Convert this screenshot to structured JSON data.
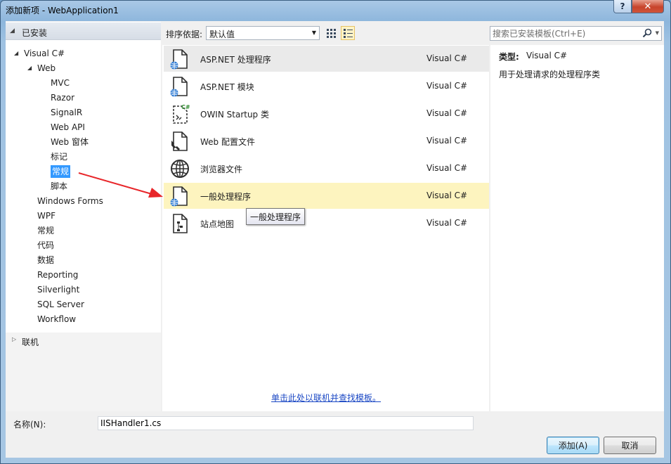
{
  "window": {
    "title": "添加新项 - WebApplication1",
    "help": "?",
    "close": "✕"
  },
  "tree": {
    "installed": "已安装",
    "items": [
      {
        "label": "Visual C#",
        "depth": 0,
        "expanded": true
      },
      {
        "label": "Web",
        "depth": 1,
        "expanded": true
      },
      {
        "label": "MVC",
        "depth": 2
      },
      {
        "label": "Razor",
        "depth": 2
      },
      {
        "label": "SignalR",
        "depth": 2
      },
      {
        "label": "Web API",
        "depth": 2
      },
      {
        "label": "Web 窗体",
        "depth": 2
      },
      {
        "label": "标记",
        "depth": 2
      },
      {
        "label": "常规",
        "depth": 2,
        "selected": true
      },
      {
        "label": "脚本",
        "depth": 2
      },
      {
        "label": "Windows Forms",
        "depth": 1
      },
      {
        "label": "WPF",
        "depth": 1
      },
      {
        "label": "常规",
        "depth": 1
      },
      {
        "label": "代码",
        "depth": 1
      },
      {
        "label": "数据",
        "depth": 1
      },
      {
        "label": "Reporting",
        "depth": 1
      },
      {
        "label": "Silverlight",
        "depth": 1
      },
      {
        "label": "SQL Server",
        "depth": 1
      },
      {
        "label": "Workflow",
        "depth": 1
      }
    ],
    "online": "联机"
  },
  "toolbar": {
    "sort_label": "排序依据:",
    "sort_value": "默认值",
    "search_placeholder": "搜索已安装模板(Ctrl+E)"
  },
  "templates": [
    {
      "name": "ASP.NET 处理程序",
      "lang": "Visual C#",
      "icon": "web-file-icon",
      "state": "hover"
    },
    {
      "name": "ASP.NET 模块",
      "lang": "Visual C#",
      "icon": "web-file-icon"
    },
    {
      "name": "OWIN Startup 类",
      "lang": "Visual C#",
      "icon": "csharp-class-icon"
    },
    {
      "name": "Web 配置文件",
      "lang": "Visual C#",
      "icon": "wrench-file-icon"
    },
    {
      "name": "浏览器文件",
      "lang": "Visual C#",
      "icon": "globe-icon"
    },
    {
      "name": "一般处理程序",
      "lang": "Visual C#",
      "icon": "web-file-icon",
      "state": "selected"
    },
    {
      "name": "站点地图",
      "lang": "Visual C#",
      "icon": "sitemap-icon"
    }
  ],
  "tooltip": "一般处理程序",
  "online_link": "单击此处以联机并查找模板。",
  "details": {
    "type_label": "类型:",
    "type_value": "Visual C#",
    "description": "用于处理请求的处理程序类"
  },
  "bottom": {
    "name_label": "名称(N):",
    "name_value": "IISHandler1.cs",
    "add_label": "添加(A)",
    "cancel_label": "取消"
  },
  "colors": {
    "selection": "#3399ff",
    "row_selected": "#fdf4bf",
    "arrow": "#e8262a",
    "link": "#1a47c4"
  }
}
